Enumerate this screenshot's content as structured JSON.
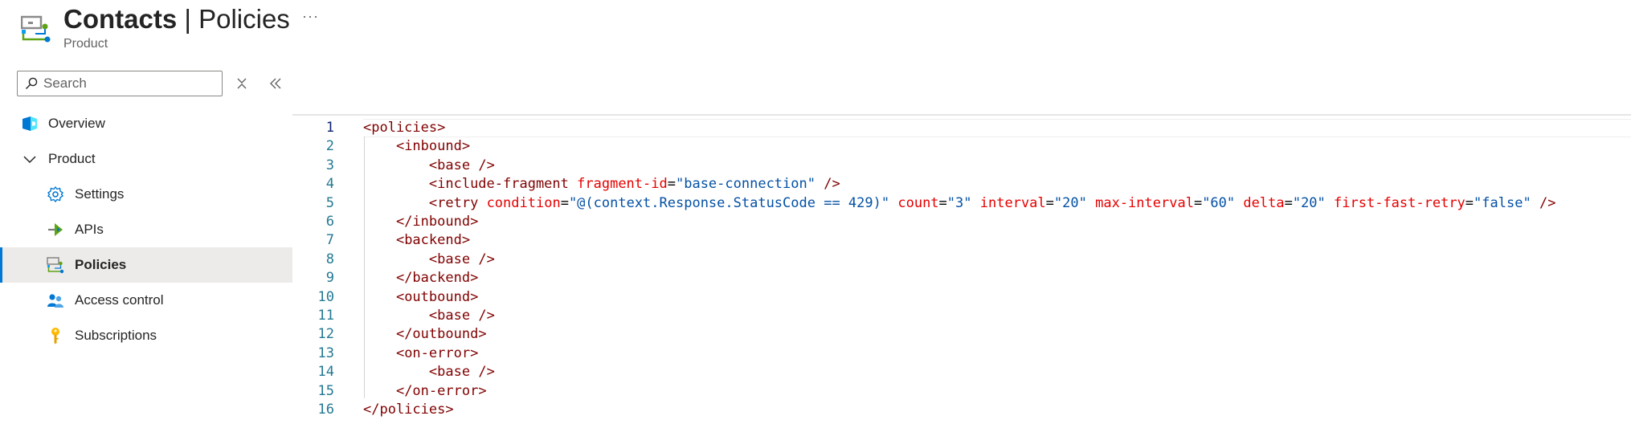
{
  "header": {
    "title_bold": "Contacts",
    "title_rest": " | Policies",
    "subtitle": "Product",
    "more_label": "···"
  },
  "search": {
    "placeholder": "Search"
  },
  "nav": [
    {
      "label": "Overview",
      "icon": "overview-icon"
    },
    {
      "label": "Product",
      "icon": "chevron-down-icon"
    },
    {
      "label": "Settings",
      "icon": "gear-icon"
    },
    {
      "label": "APIs",
      "icon": "api-icon"
    },
    {
      "label": "Policies",
      "icon": "policies-icon",
      "active": true
    },
    {
      "label": "Access control",
      "icon": "people-icon"
    },
    {
      "label": "Subscriptions",
      "icon": "key-icon"
    }
  ],
  "editor": {
    "line_numbers": [
      "1",
      "2",
      "3",
      "4",
      "5",
      "6",
      "7",
      "8",
      "9",
      "10",
      "11",
      "12",
      "13",
      "14",
      "15",
      "16"
    ],
    "lines": [
      "<policies>",
      "    <inbound>",
      "        <base />",
      "        <include-fragment fragment-id=\"base-connection\" />",
      "        <retry condition=\"@(context.Response.StatusCode == 429)\" count=\"3\" interval=\"20\" max-interval=\"60\" delta=\"20\" first-fast-retry=\"false\" />",
      "    </inbound>",
      "    <backend>",
      "        <base />",
      "    </backend>",
      "    <outbound>",
      "        <base />",
      "    </outbound>",
      "    <on-error>",
      "        <base />",
      "    </on-error>",
      "</policies>"
    ]
  },
  "colors": {
    "accent": "#0078d4",
    "tag": "#800000",
    "attr": "#e50000",
    "value": "#0451a5",
    "line_number": "#237893"
  }
}
